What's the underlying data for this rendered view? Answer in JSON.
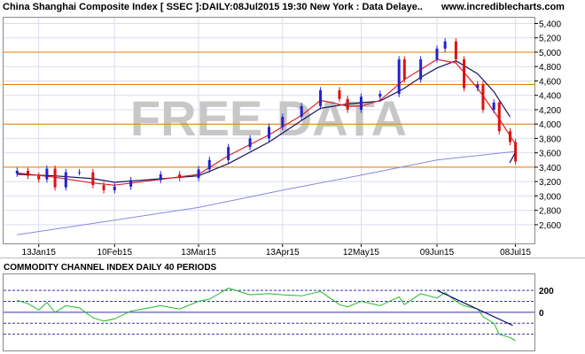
{
  "header": {
    "title": "China Shanghai Composite Index [ SSEC ]:DAILY:08Jul2015 19:30 New York : Data Delaye..",
    "site": "www.incrediblecharts.com"
  },
  "watermark": "FREE DATA",
  "colors": {
    "background": "#ffffff",
    "panel_border": "#8a8a8a",
    "grid": "#dcdcf0",
    "candle_up": "#2222cc",
    "candle_down": "#dd1111",
    "ma_short": "#e02020",
    "ma_medium": "#141460",
    "ma_long": "#8888dd",
    "support_resistance": "#e08000",
    "cci_line": "#22bb22",
    "cci_level": "#3333aa",
    "trendline": "#0a0a6a",
    "watermark": "#c7c7c7"
  },
  "chart_data": [
    {
      "type": "line",
      "title": "China Shanghai Composite Index [ SSEC ]:DAILY:08Jul2015 19:30 New York : Data Delaye..",
      "xlabel": "",
      "ylabel": "",
      "ylim": [
        2340,
        5480
      ],
      "yticks": [
        2600,
        2800,
        3000,
        3200,
        3400,
        3600,
        3800,
        4000,
        4200,
        4400,
        4600,
        4800,
        5000,
        5200,
        5400
      ],
      "ytick_labels": [
        "2,600",
        "2,800",
        "3,000",
        "3,200",
        "3,400",
        "3,600",
        "3,800",
        "4,000",
        "4,200",
        "4,400",
        "4,600",
        "4,800",
        "5,000",
        "5,200",
        "5,400"
      ],
      "x_labels": [
        {
          "label": "13Jan15",
          "x": "2015-01-13"
        },
        {
          "label": "10Feb15",
          "x": "2015-02-10"
        },
        {
          "label": "13Mar15",
          "x": "2015-03-13"
        },
        {
          "label": "13Apr15",
          "x": "2015-04-13"
        },
        {
          "label": "12May15",
          "x": "2015-05-12"
        },
        {
          "label": "09Jun15",
          "x": "2015-06-09"
        },
        {
          "label": "08Jul15",
          "x": "2015-07-08"
        }
      ],
      "grid": true,
      "horizontal_levels": [
        3400,
        4000,
        4550,
        5000
      ],
      "series": [
        {
          "kind": "close",
          "values": [
            [
              "2015-01-05",
              3350
            ],
            [
              "2015-01-09",
              3280
            ],
            [
              "2015-01-13",
              3230
            ],
            [
              "2015-01-16",
              3380
            ],
            [
              "2015-01-19",
              3120
            ],
            [
              "2015-01-23",
              3330
            ],
            [
              "2015-01-28",
              3330
            ],
            [
              "2015-02-02",
              3150
            ],
            [
              "2015-02-06",
              3080
            ],
            [
              "2015-02-10",
              3130
            ],
            [
              "2015-02-16",
              3220
            ],
            [
              "2015-02-27",
              3300
            ],
            [
              "2015-03-06",
              3250
            ],
            [
              "2015-03-13",
              3370
            ],
            [
              "2015-03-17",
              3500
            ],
            [
              "2015-03-24",
              3680
            ],
            [
              "2015-04-01",
              3800
            ],
            [
              "2015-04-08",
              3960
            ],
            [
              "2015-04-13",
              4100
            ],
            [
              "2015-04-20",
              4250
            ],
            [
              "2015-04-27",
              4470
            ],
            [
              "2015-05-04",
              4350
            ],
            [
              "2015-05-07",
              4200
            ],
            [
              "2015-05-12",
              4380
            ],
            [
              "2015-05-19",
              4420
            ],
            [
              "2015-05-26",
              4900
            ],
            [
              "2015-05-28",
              4620
            ],
            [
              "2015-06-03",
              4900
            ],
            [
              "2015-06-09",
              5050
            ],
            [
              "2015-06-12",
              5150
            ],
            [
              "2015-06-16",
              4900
            ],
            [
              "2015-06-19",
              4500
            ],
            [
              "2015-06-24",
              4550
            ],
            [
              "2015-06-26",
              4200
            ],
            [
              "2015-06-30",
              4300
            ],
            [
              "2015-07-02",
              3900
            ],
            [
              "2015-07-06",
              3750
            ],
            [
              "2015-07-08",
              3480
            ]
          ]
        },
        {
          "kind": "moving-average-short",
          "values": [
            [
              "2015-01-05",
              3320
            ],
            [
              "2015-01-19",
              3260
            ],
            [
              "2015-02-02",
              3180
            ],
            [
              "2015-02-10",
              3150
            ],
            [
              "2015-02-27",
              3230
            ],
            [
              "2015-03-13",
              3300
            ],
            [
              "2015-03-24",
              3560
            ],
            [
              "2015-04-08",
              3850
            ],
            [
              "2015-04-20",
              4120
            ],
            [
              "2015-04-27",
              4330
            ],
            [
              "2015-05-07",
              4250
            ],
            [
              "2015-05-12",
              4250
            ],
            [
              "2015-05-19",
              4330
            ],
            [
              "2015-05-28",
              4620
            ],
            [
              "2015-06-03",
              4760
            ],
            [
              "2015-06-09",
              4900
            ],
            [
              "2015-06-16",
              4850
            ],
            [
              "2015-06-24",
              4500
            ],
            [
              "2015-07-02",
              4070
            ],
            [
              "2015-07-08",
              3720
            ]
          ]
        },
        {
          "kind": "moving-average-medium",
          "values": [
            [
              "2015-01-05",
              3300
            ],
            [
              "2015-01-19",
              3280
            ],
            [
              "2015-02-02",
              3240
            ],
            [
              "2015-02-10",
              3190
            ],
            [
              "2015-03-13",
              3280
            ],
            [
              "2015-03-24",
              3450
            ],
            [
              "2015-04-08",
              3750
            ],
            [
              "2015-04-20",
              4050
            ],
            [
              "2015-04-27",
              4220
            ],
            [
              "2015-05-07",
              4280
            ],
            [
              "2015-05-19",
              4320
            ],
            [
              "2015-05-28",
              4500
            ],
            [
              "2015-06-03",
              4650
            ],
            [
              "2015-06-09",
              4780
            ],
            [
              "2015-06-16",
              4880
            ],
            [
              "2015-06-24",
              4700
            ],
            [
              "2015-06-30",
              4450
            ],
            [
              "2015-07-06",
              4100
            ]
          ]
        },
        {
          "kind": "moving-average-long",
          "values": [
            [
              "2015-01-05",
              2460
            ],
            [
              "2015-02-06",
              2640
            ],
            [
              "2015-03-13",
              2840
            ],
            [
              "2015-04-13",
              3080
            ],
            [
              "2015-05-12",
              3290
            ],
            [
              "2015-06-09",
              3500
            ],
            [
              "2015-07-08",
              3620
            ]
          ]
        }
      ]
    },
    {
      "type": "line",
      "title": "COMMODITY CHANNEL INDEX DAILY 40 PERIODS",
      "xlabel": "",
      "ylabel": "",
      "ylim": [
        -340,
        330
      ],
      "yticks": [
        200,
        0
      ],
      "ytick_labels": [
        "200",
        "0"
      ],
      "horizontal_levels": [
        200,
        100,
        0,
        -100,
        -200
      ],
      "series": [
        {
          "kind": "cci",
          "values": [
            [
              "2015-01-05",
              110
            ],
            [
              "2015-01-09",
              80
            ],
            [
              "2015-01-13",
              20
            ],
            [
              "2015-01-16",
              90
            ],
            [
              "2015-01-19",
              0
            ],
            [
              "2015-01-23",
              60
            ],
            [
              "2015-01-28",
              40
            ],
            [
              "2015-02-02",
              -50
            ],
            [
              "2015-02-06",
              -80
            ],
            [
              "2015-02-10",
              -60
            ],
            [
              "2015-02-16",
              10
            ],
            [
              "2015-02-27",
              60
            ],
            [
              "2015-03-06",
              30
            ],
            [
              "2015-03-13",
              100
            ],
            [
              "2015-03-17",
              120
            ],
            [
              "2015-03-24",
              220
            ],
            [
              "2015-04-01",
              160
            ],
            [
              "2015-04-08",
              170
            ],
            [
              "2015-04-13",
              160
            ],
            [
              "2015-04-20",
              150
            ],
            [
              "2015-04-27",
              190
            ],
            [
              "2015-05-04",
              70
            ],
            [
              "2015-05-07",
              50
            ],
            [
              "2015-05-12",
              100
            ],
            [
              "2015-05-19",
              60
            ],
            [
              "2015-05-26",
              140
            ],
            [
              "2015-05-28",
              70
            ],
            [
              "2015-06-03",
              170
            ],
            [
              "2015-06-09",
              130
            ],
            [
              "2015-06-12",
              180
            ],
            [
              "2015-06-16",
              100
            ],
            [
              "2015-06-19",
              60
            ],
            [
              "2015-06-24",
              30
            ],
            [
              "2015-06-26",
              -40
            ],
            [
              "2015-06-30",
              -100
            ],
            [
              "2015-07-02",
              -200
            ],
            [
              "2015-07-06",
              -230
            ],
            [
              "2015-07-08",
              -260
            ]
          ]
        }
      ]
    }
  ]
}
